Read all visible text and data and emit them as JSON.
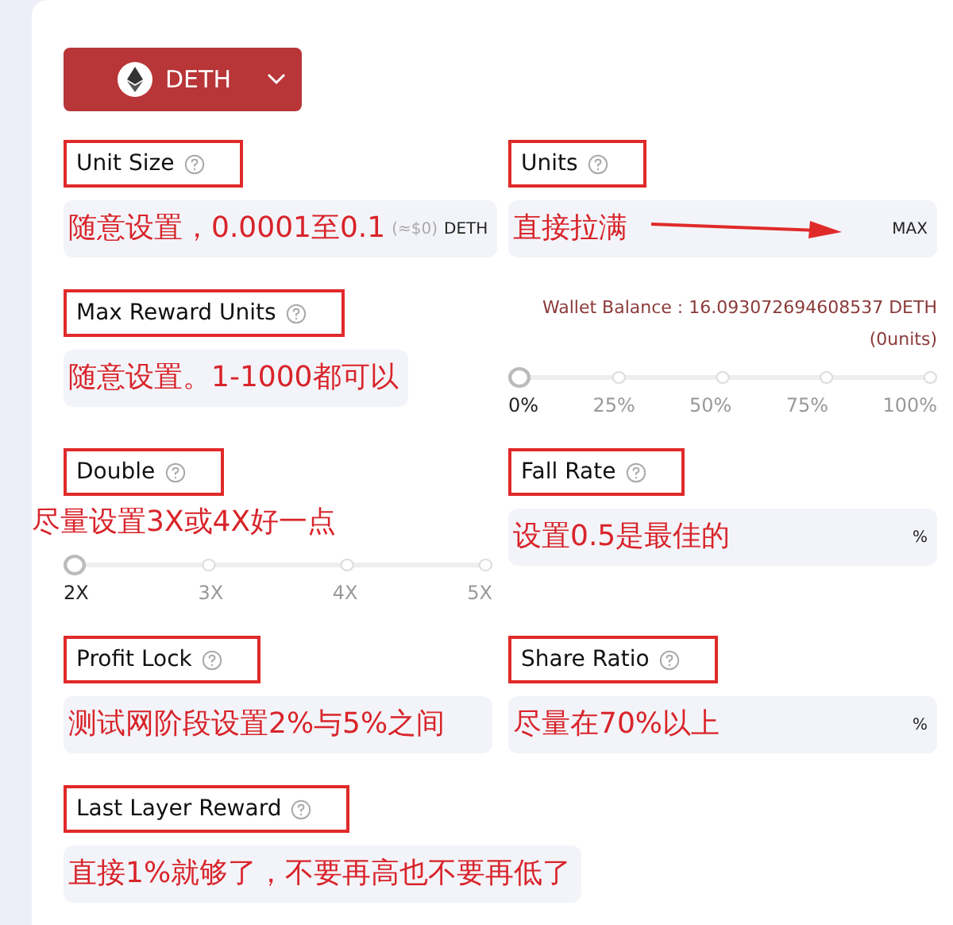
{
  "token_button": {
    "label": "DETH"
  },
  "fields": [
    {
      "kind": "input",
      "label": "Unit Size",
      "annotation": "随意设置，0.0001至0.1",
      "suffixes": [
        "(≈$0)",
        "DETH"
      ]
    },
    {
      "kind": "input",
      "label": "Units",
      "annotation": "直接拉满",
      "suffixes": [
        "MAX"
      ],
      "annotation_arrow": true
    },
    {
      "kind": "short_input",
      "label": "Max Reward Units",
      "annotation": "随意设置。1-1000都可以"
    },
    {
      "kind": "balance",
      "balance": "Wallet Balance : 16.093072694608537 DETH",
      "units": "(0units)",
      "level": 0,
      "marks": [
        "0%",
        "25%",
        "50%",
        "75%",
        "100%"
      ]
    },
    {
      "kind": "slider",
      "label": "Double",
      "annotation": "尽量设置3X或4X好一点",
      "level": 0,
      "marks": [
        "2X",
        "3X",
        "4X",
        "5X"
      ]
    },
    {
      "kind": "input",
      "label": "Fall Rate",
      "annotation": "设置0.5是最佳的",
      "suffixes": [
        "%"
      ]
    },
    {
      "kind": "input",
      "label": "Profit Lock",
      "annotation": "测试网阶段设置2%与5%之间"
    },
    {
      "kind": "input",
      "label": "Share Ratio",
      "annotation": "尽量在70%以上",
      "suffixes": [
        "%"
      ]
    },
    {
      "kind": "input",
      "label": "Last Layer Reward",
      "annotation": "直接1%就够了，不要再高也不要再低了"
    }
  ]
}
